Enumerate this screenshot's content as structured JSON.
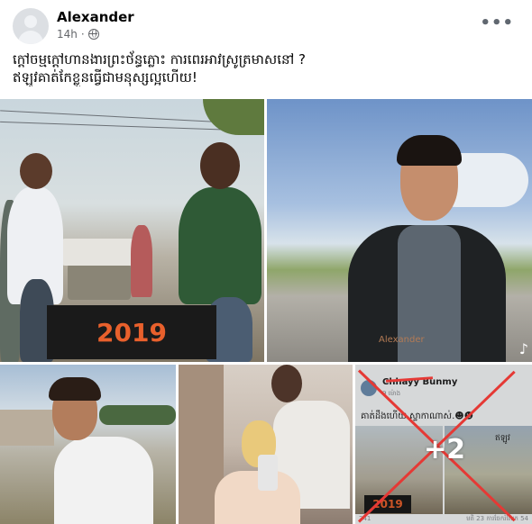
{
  "post": {
    "author": "Alexander",
    "time": "14h",
    "dot": "·",
    "more_icon": "more-options-icon",
    "privacy_icon": "globe-icon",
    "caption_lines": [
      "ក្ដៅចម្មក្ដៅហានងារព្រះថ័ន្ធភ្លោះ ការពេរអាវស្រូត្រមាសនៅ ?",
      "ឥឡូវគាត់កែខ្លួនធ្វើជាមនុស្សល្អហើយ!"
    ]
  },
  "photos": {
    "photo1": {
      "overlay_text": "2019"
    },
    "photo2": {
      "watermark": "Alexander",
      "tiktok_icon": "tiktok-icon"
    },
    "photo5": {
      "name": "Chhayy Bunmy",
      "meta": "9 ម៉ោង",
      "caption": "គាត់ដឹងហើយ ស្ទាកាណាស់.☻☻",
      "mini_year": "2019",
      "mini_tag": "ឥឡូវ",
      "footer_left": "241",
      "footer_right": "មតិ 23 ការចែករំលែក 54",
      "more_count": "+2"
    }
  },
  "colors": {
    "year_text": "#e8602c",
    "cross": "#e53935",
    "author": "#050505",
    "meta": "#65676b"
  }
}
